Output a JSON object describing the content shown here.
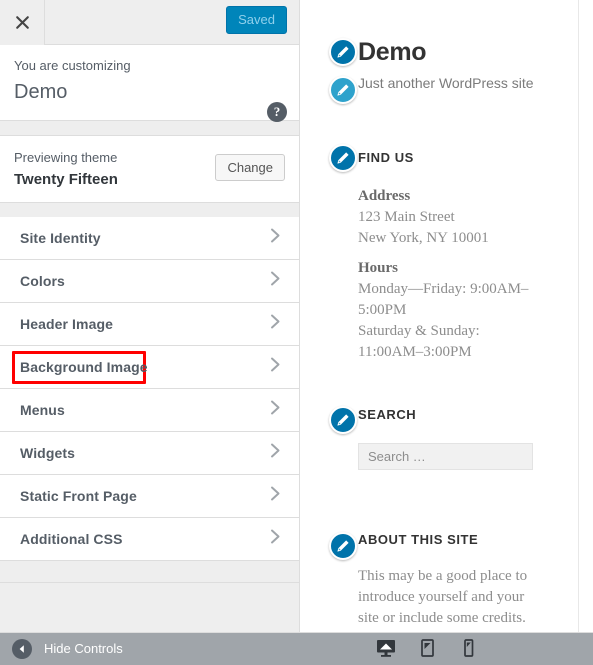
{
  "sidebar": {
    "close_icon": "close-x-icon",
    "save_label": "Saved",
    "customizing_label": "You are customizing",
    "site_name": "Demo",
    "help_icon": "help-question-icon",
    "theme": {
      "previewing_label": "Previewing theme",
      "theme_name": "Twenty Fifteen",
      "change_label": "Change"
    },
    "sections": [
      {
        "label": "Site Identity",
        "icon": "chevron-right-icon",
        "highlighted": false
      },
      {
        "label": "Colors",
        "icon": "chevron-right-icon",
        "highlighted": false
      },
      {
        "label": "Header Image",
        "icon": "chevron-right-icon",
        "highlighted": false
      },
      {
        "label": "Background Image",
        "icon": "chevron-right-icon",
        "highlighted": true
      },
      {
        "label": "Menus",
        "icon": "chevron-right-icon",
        "highlighted": false
      },
      {
        "label": "Widgets",
        "icon": "chevron-right-icon",
        "highlighted": false
      },
      {
        "label": "Static Front Page",
        "icon": "chevron-right-icon",
        "highlighted": false
      },
      {
        "label": "Additional CSS",
        "icon": "chevron-right-icon",
        "highlighted": false
      }
    ],
    "footer": {
      "collapse_label": "Hide Controls",
      "collapse_icon": "collapse-left-arrow-icon",
      "devices": [
        {
          "name": "desktop-preview-icon",
          "active": true
        },
        {
          "name": "tablet-preview-icon",
          "active": false
        },
        {
          "name": "mobile-preview-icon",
          "active": false
        }
      ]
    }
  },
  "preview": {
    "site_title": "Demo",
    "site_tagline": "Just another WordPress site",
    "widgets": [
      {
        "title": "FIND US",
        "groups": [
          {
            "heading": "Address",
            "lines": [
              "123 Main Street",
              "New York, NY 10001"
            ]
          },
          {
            "heading": "Hours",
            "lines": [
              "Monday—Friday: 9:00AM–5:00PM",
              "Saturday & Sunday: 11:00AM–3:00PM"
            ]
          }
        ]
      },
      {
        "title": "SEARCH",
        "search_placeholder": "Search …"
      },
      {
        "title": "ABOUT THIS SITE",
        "paragraph": "This may be a good place to introduce yourself and your site or include some credits."
      }
    ]
  },
  "colors": {
    "accent_blue": "#0085ba",
    "pencil_blue": "#2ea2cc",
    "pencil_blue_dark": "#0073aa",
    "highlight_red": "#ff0000",
    "footer_gray": "#a0a5aa",
    "sidebar_gray": "#eeeeee"
  }
}
